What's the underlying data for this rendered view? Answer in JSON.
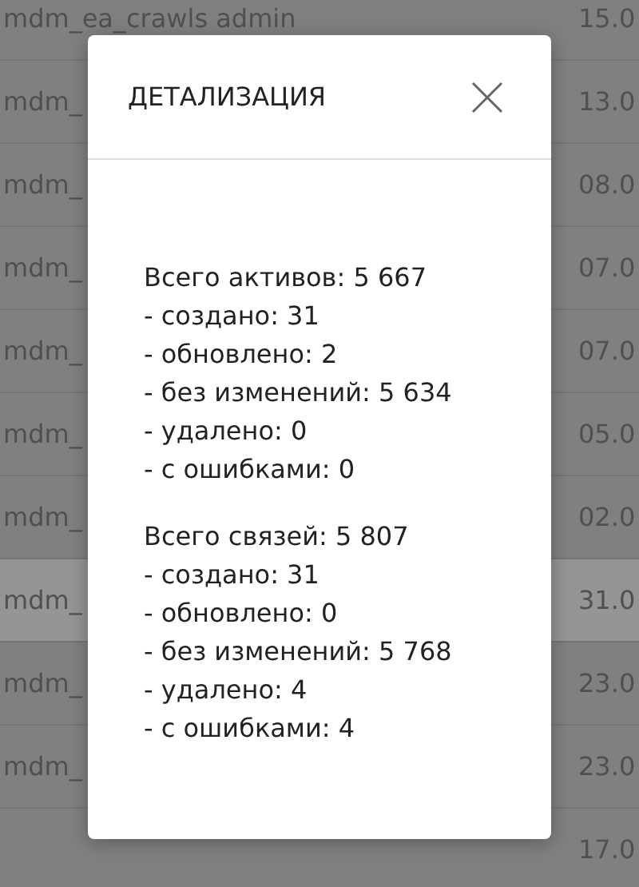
{
  "background_table": {
    "rows": [
      {
        "column_1": "mdm_ea_crawls admin",
        "column_2": "15.0",
        "selected": false
      },
      {
        "column_1": "mdm_",
        "column_2": "13.0",
        "selected": false
      },
      {
        "column_1": "mdm_",
        "column_2": "08.0",
        "selected": false
      },
      {
        "column_1": "mdm_",
        "column_2": "07.0",
        "selected": false
      },
      {
        "column_1": "mdm_",
        "column_2": "07.0",
        "selected": false
      },
      {
        "column_1": "mdm_",
        "column_2": "05.0",
        "selected": false
      },
      {
        "column_1": "mdm_",
        "column_2": "02.0",
        "selected": false
      },
      {
        "column_1": "mdm_",
        "column_2": "31.0",
        "selected": true
      },
      {
        "column_1": "mdm_",
        "column_2": "23.0",
        "selected": false
      },
      {
        "column_1": "mdm_",
        "column_2": "23.0",
        "selected": false
      },
      {
        "column_2": "17.0",
        "selected": false
      }
    ]
  },
  "modal": {
    "title": "ДЕТАЛИЗАЦИЯ",
    "groups": [
      {
        "total": "Всего активов: 5 667",
        "items": [
          "- создано: 31",
          "- обновлено: 2",
          "- без изменений: 5 634",
          "- удалено: 0",
          "- с ошибками: 0"
        ]
      },
      {
        "total": "Всего связей: 5 807",
        "items": [
          "- создано: 31",
          "- обновлено: 0",
          "- без изменений: 5 768",
          "- удалено: 4",
          "- с ошибками: 4"
        ]
      }
    ]
  }
}
